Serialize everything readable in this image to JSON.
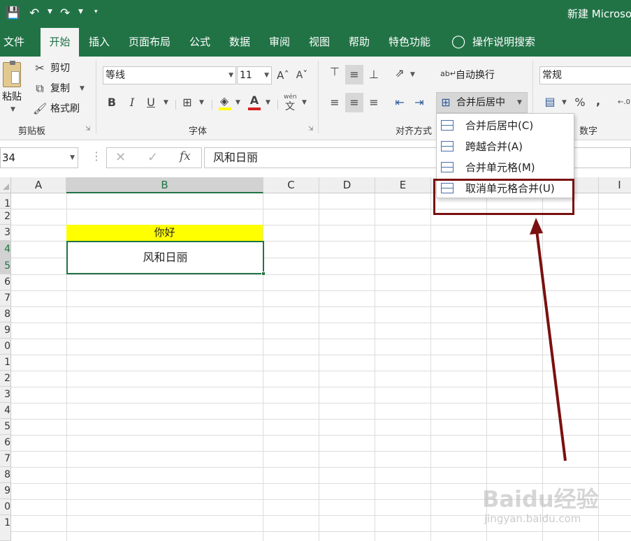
{
  "title_bar": {
    "window_title": "新建 Microso",
    "accent": "#217346"
  },
  "tabs": [
    {
      "label": "文件"
    },
    {
      "label": "开始"
    },
    {
      "label": "插入"
    },
    {
      "label": "页面布局"
    },
    {
      "label": "公式"
    },
    {
      "label": "数据"
    },
    {
      "label": "审阅"
    },
    {
      "label": "视图"
    },
    {
      "label": "帮助"
    },
    {
      "label": "特色功能"
    }
  ],
  "tell_me": "操作说明搜索",
  "ribbon": {
    "clipboard": {
      "paste": "粘贴",
      "cut": "剪切",
      "copy": "复制",
      "format_painter": "格式刷",
      "group_label": "剪贴板"
    },
    "font": {
      "font_name": "等线",
      "font_size": "11",
      "bold": "B",
      "italic": "I",
      "underline": "U",
      "wen": "wén",
      "group_label": "字体"
    },
    "alignment": {
      "wrap_text": "自动换行",
      "merge_center": "合并后居中",
      "group_label": "对齐方式"
    },
    "number": {
      "format": "常规",
      "percent": "%",
      "comma": ",",
      "group_label": "数字"
    }
  },
  "formula_bar": {
    "name_box": "34",
    "fx": "fx",
    "content": "风和日丽"
  },
  "columns": [
    "A",
    "B",
    "C",
    "D",
    "E"
  ],
  "last_column": "I",
  "rows": [
    "1",
    "2",
    "3",
    "4",
    "5",
    "6",
    "7",
    "8",
    "9",
    "0",
    "1",
    "2",
    "3",
    "4",
    "5",
    "6",
    "7",
    "8",
    "9",
    "0",
    "1"
  ],
  "cells": {
    "B3": "你好",
    "B4": "风和日丽",
    "B3_fill": "#ffff00"
  },
  "merge_menu": [
    {
      "label": "合并后居中(C)"
    },
    {
      "label": "跨越合并(A)"
    },
    {
      "label": "合并单元格(M)"
    },
    {
      "label": "取消单元格合并(U)"
    }
  ],
  "annotation_color": "#7a1010",
  "watermark": {
    "brand": "Baidu经验",
    "url": "jingyan.baidu.com"
  }
}
